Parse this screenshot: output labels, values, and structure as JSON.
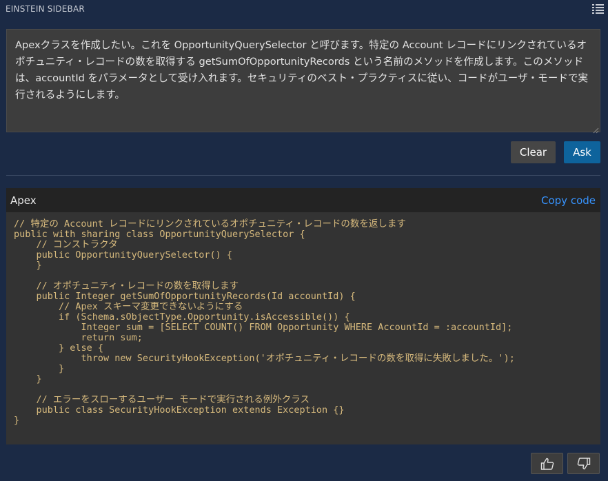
{
  "header": {
    "title": "EINSTEIN SIDEBAR",
    "menu_icon": "list-icon"
  },
  "prompt": {
    "value": "Apexクラスを作成したい。これを OpportunityQuerySelector と呼びます。特定の Account レコードにリンクされているオポチュニティ・レコードの数を取得する getSumOfOpportunityRecords という名前のメソッドを作成します。このメソッドは、accountId をパラメータとして受け入れます。セキュリティのベスト・プラクティスに従い、コードがユーザ・モードで実行されるようにします。"
  },
  "actions": {
    "clear_label": "Clear",
    "ask_label": "Ask"
  },
  "code_block": {
    "language": "Apex",
    "copy_label": "Copy code",
    "code": "// 特定の Account レコードにリンクされているオポチュニティ・レコードの数を返します\npublic with sharing class OpportunityQuerySelector {\n    // コンストラクタ\n    public OpportunityQuerySelector() {\n    }\n\n    // オポチュニティ・レコードの数を取得します\n    public Integer getSumOfOpportunityRecords(Id accountId) {\n        // Apex スキーマ変更できないようにする\n        if (Schema.sObjectType.Opportunity.isAccessible()) {\n            Integer sum = [SELECT COUNT() FROM Opportunity WHERE AccountId = :accountId];\n            return sum;\n        } else {\n            throw new SecurityHookException('オポチュニティ・レコードの数を取得に失敗しました。');\n        }\n    }\n\n    // エラーをスローするユーザー モードで実行される例外クラス\n    public class SecurityHookException extends Exception {}\n}"
  },
  "feedback": {
    "thumbs_up_icon": "thumbs-up-icon",
    "thumbs_down_icon": "thumbs-down-icon"
  },
  "colors": {
    "background": "#1b2a45",
    "panel": "#3d3d3d",
    "code_background": "#333333",
    "code_text": "#d7ba7d",
    "accent": "#0e639c",
    "link": "#3794ff"
  }
}
